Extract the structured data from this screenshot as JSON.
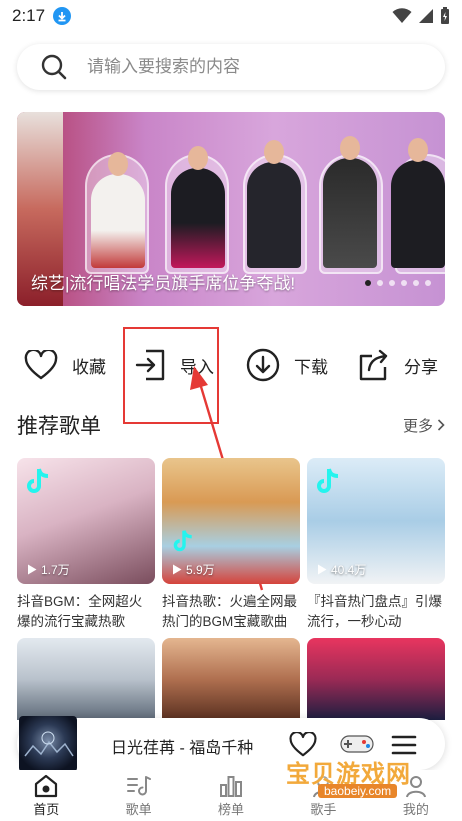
{
  "status_bar": {
    "time": "2:17"
  },
  "search": {
    "placeholder": "请输入要搜索的内容"
  },
  "banner": {
    "caption": "综艺|流行唱法学员旗手席位争夺战!",
    "dot_count": 6,
    "active_dot": 0
  },
  "actions": [
    {
      "label": "收藏",
      "icon": "heart-icon"
    },
    {
      "label": "导入",
      "icon": "import-icon"
    },
    {
      "label": "下载",
      "icon": "download-icon"
    },
    {
      "label": "分享",
      "icon": "share-icon"
    }
  ],
  "section": {
    "title": "推荐歌单",
    "more": "更多"
  },
  "playlists": [
    {
      "play_count": "1.7万",
      "title": "抖音BGM：全网超火爆的流行宝藏热歌",
      "colors": [
        "#f4d9e4",
        "#b88aa0"
      ]
    },
    {
      "play_count": "5.9万",
      "title": "抖音热歌：火遍全网最热门的BGM宝藏歌曲",
      "colors": [
        "#e8b56a",
        "#6aa3c8"
      ]
    },
    {
      "play_count": "40.4万",
      "title": "『抖音热门盘点』引爆流行，一秒心动",
      "colors": [
        "#cfe6f5",
        "#86b7d8"
      ]
    }
  ],
  "playlists_row2": [
    {
      "colors": [
        "#dfe6ee",
        "#7a8796"
      ]
    },
    {
      "colors": [
        "#d9a27a",
        "#6b3b2a"
      ]
    },
    {
      "colors": [
        "#e7355f",
        "#1c1e40"
      ]
    }
  ],
  "player": {
    "song": "日光荏苒 - 福岛千种"
  },
  "tabs": [
    {
      "label": "首页",
      "icon": "home-icon",
      "active": true
    },
    {
      "label": "歌单",
      "icon": "music-note-icon",
      "active": false
    },
    {
      "label": "榜单",
      "icon": "chart-icon",
      "active": false
    },
    {
      "label": "歌手",
      "icon": "singer-icon",
      "active": false
    },
    {
      "label": "我的",
      "icon": "user-icon",
      "active": false
    }
  ],
  "watermark": {
    "text": "宝贝游戏网",
    "url": "baobeiy.com"
  },
  "colors": {
    "accent": "#2196f3",
    "highlight": "#e53935",
    "watermark": "#f2a93b"
  }
}
